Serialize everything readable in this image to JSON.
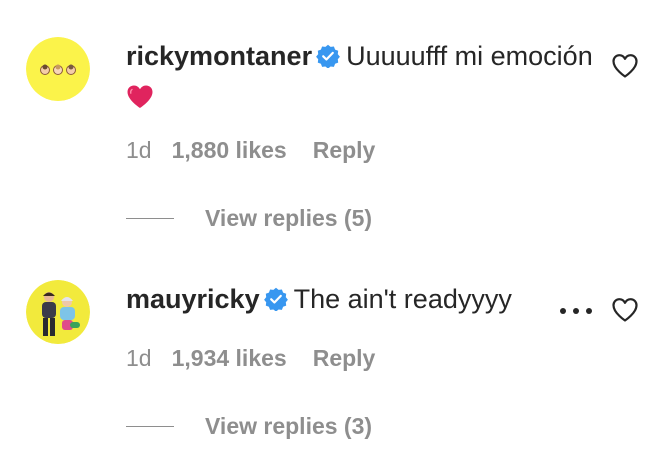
{
  "comments": [
    {
      "username": "rickymontaner",
      "text": "Uuuuufff mi emoción",
      "emoji": "❤️",
      "timestamp": "1d",
      "likes": "1,880 likes",
      "reply_label": "Reply",
      "view_replies_label": "View replies (5)",
      "verified": true,
      "avatar_bg": "#fbf34a"
    },
    {
      "username": "mauyricky",
      "text": "The ain't readyyyy",
      "timestamp": "1d",
      "likes": "1,934 likes",
      "reply_label": "Reply",
      "view_replies_label": "View replies (3)",
      "verified": true,
      "avatar_bg": "#f2ea3c"
    }
  ],
  "colors": {
    "text": "#262626",
    "secondary": "#8e8e8e",
    "verified": "#3897f0",
    "emoji_heart": "#e0245e"
  },
  "icons": [
    "verified-badge-icon",
    "heart-icon",
    "more-options-icon",
    "red-heart-emoji"
  ]
}
